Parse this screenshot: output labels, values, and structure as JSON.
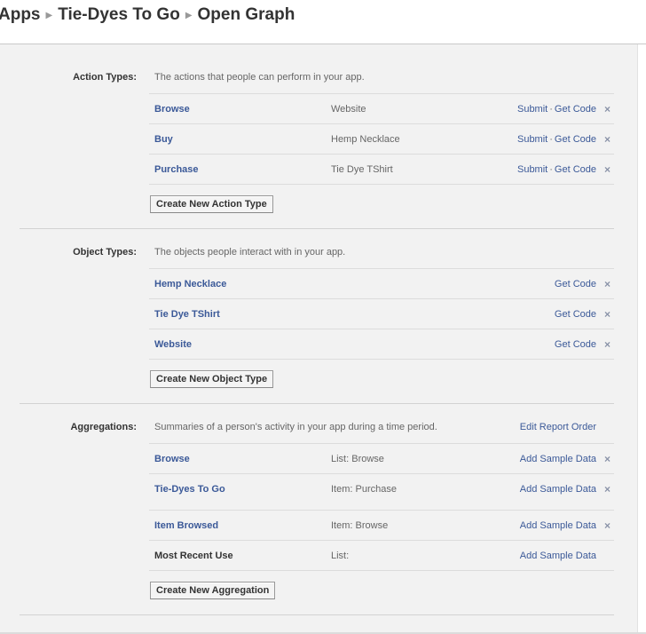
{
  "breadcrumb": {
    "apps": "Apps",
    "app": "Tie-Dyes To Go",
    "page": "Open Graph"
  },
  "action_types": {
    "label": "Action Types:",
    "description": "The actions that people can perform in your app.",
    "rows": [
      {
        "name": "Browse",
        "detail": "Website",
        "submit": "Submit",
        "get_code": "Get Code",
        "remove": "×"
      },
      {
        "name": "Buy",
        "detail": "Hemp Necklace",
        "submit": "Submit",
        "get_code": "Get Code",
        "remove": "×"
      },
      {
        "name": "Purchase",
        "detail": "Tie Dye TShirt",
        "submit": "Submit",
        "get_code": "Get Code",
        "remove": "×"
      }
    ],
    "button": "Create New Action Type"
  },
  "object_types": {
    "label": "Object Types:",
    "description": "The objects people interact with in your app.",
    "rows": [
      {
        "name": "Hemp Necklace",
        "get_code": "Get Code",
        "remove": "×"
      },
      {
        "name": "Tie Dye TShirt",
        "get_code": "Get Code",
        "remove": "×"
      },
      {
        "name": "Website",
        "get_code": "Get Code",
        "remove": "×"
      }
    ],
    "button": "Create New Object Type"
  },
  "aggregations": {
    "label": "Aggregations:",
    "description": "Summaries of a person's activity in your app during a time period.",
    "edit_report_order": "Edit Report Order",
    "rows": [
      {
        "name": "Browse",
        "detail": "List: Browse",
        "action": "Add Sample Data",
        "remove": "×"
      },
      {
        "name": "Tie-Dyes To Go",
        "detail": "Item: Purchase",
        "action": "Add Sample Data",
        "remove": "×"
      },
      {
        "name": "Item Browsed",
        "detail": "Item: Browse",
        "action": "Add Sample Data",
        "remove": "×"
      },
      {
        "name": "Most Recent Use",
        "detail": "List:",
        "action": "Add Sample Data"
      }
    ],
    "button": "Create New Aggregation"
  },
  "colors": {
    "link": "#3b5998",
    "panel_bg": "#f2f2f2",
    "border": "#dcdcdc"
  }
}
